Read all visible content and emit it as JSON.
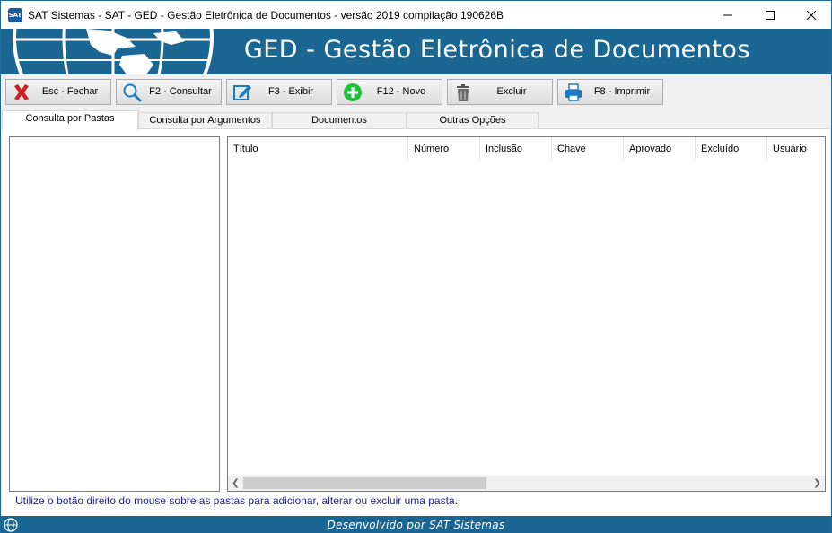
{
  "window": {
    "title": "SAT Sistemas - SAT - GED - Gestão Eletrônica de Documentos - versão 2019 compilação 190626B",
    "icon_text": "SAT"
  },
  "banner": {
    "title": "GED - Gestão Eletrônica de Documentos"
  },
  "toolbar": {
    "close_label": "Esc - Fechar",
    "search_label": "F2 - Consultar",
    "view_label": "F3 - Exibir",
    "new_label": "F12 - Novo",
    "delete_label": "Excluir",
    "print_label": "F8 - Imprimir"
  },
  "tabs": [
    {
      "label": "Consulta por Pastas",
      "active": true
    },
    {
      "label": "Consulta por Argumentos",
      "active": false
    },
    {
      "label": "Documentos",
      "active": false
    },
    {
      "label": "Outras Opções",
      "active": false
    }
  ],
  "grid": {
    "columns": [
      "Título",
      "Número",
      "Inclusão",
      "Chave",
      "Aprovado",
      "Excluído",
      "Usuário"
    ],
    "rows": []
  },
  "hint": "Utilize o botão direito do mouse sobre as pastas para adicionar, alterar ou excluir uma pasta.",
  "footer": "Desenvolvido por SAT Sistemas",
  "colors": {
    "banner": "#1b6794",
    "hint_text": "#1f1f9a"
  }
}
